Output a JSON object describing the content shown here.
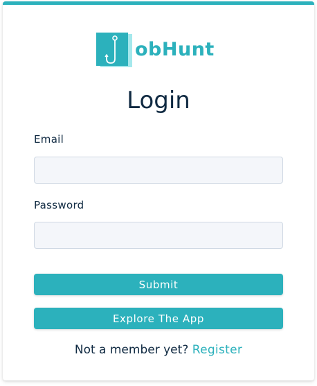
{
  "brand": {
    "logo_letter": "J",
    "logo_text": "obHunt",
    "accent": "#2cb1bc",
    "accent_light": "#a5e8ec"
  },
  "form": {
    "title": "Login",
    "email_label": "Email",
    "email_value": "",
    "password_label": "Password",
    "password_value": "",
    "submit_label": "Submit",
    "explore_label": "Explore The App"
  },
  "footer": {
    "prompt": "Not a member yet?",
    "register_link": "Register"
  },
  "icons": {
    "logo": "hook-icon"
  }
}
